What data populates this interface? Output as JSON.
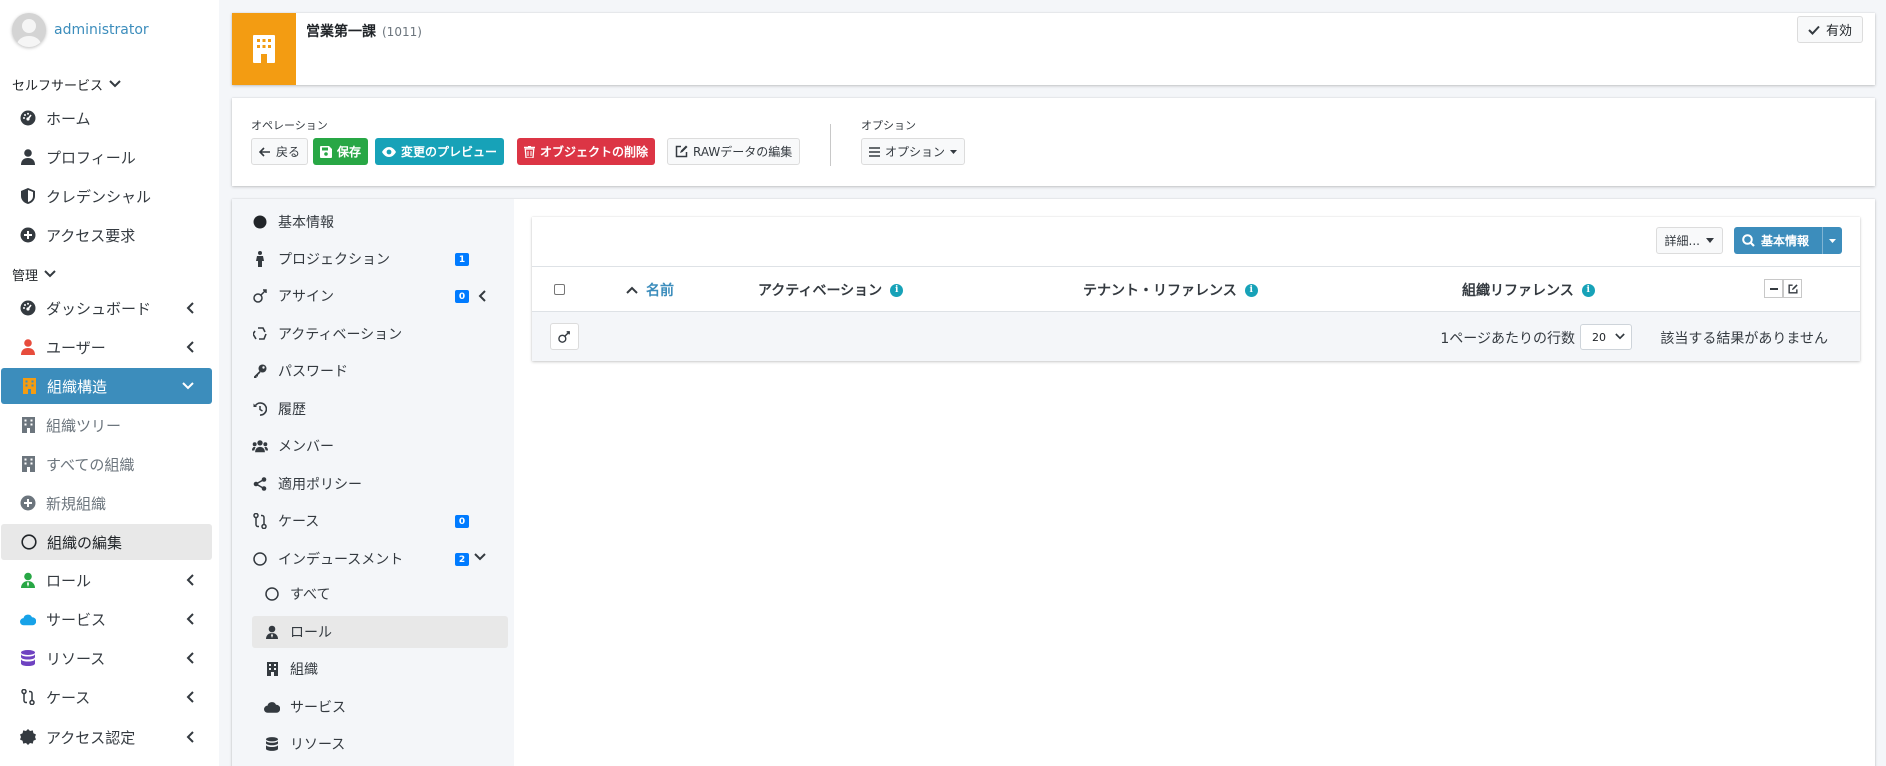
{
  "user": {
    "name": "administrator"
  },
  "sidebar": {
    "selfservice_header": "セルフサービス",
    "selfservice_items": [
      {
        "label": "ホーム",
        "icon": "dashboard-gauge-icon"
      },
      {
        "label": "プロフィール",
        "icon": "user-icon"
      },
      {
        "label": "クレデンシャル",
        "icon": "shield-icon"
      },
      {
        "label": "アクセス要求",
        "icon": "plus-circle-icon"
      }
    ],
    "admin_header": "管理",
    "admin_items": [
      {
        "label": "ダッシュボード",
        "icon": "dashboard-gauge-icon"
      },
      {
        "label": "ユーザー",
        "icon": "user-icon"
      },
      {
        "label": "組織構造",
        "icon": "building-icon"
      },
      {
        "label": "組織ツリー",
        "icon": "building-icon"
      },
      {
        "label": "すべての組織",
        "icon": "building-icon"
      },
      {
        "label": "新規組織",
        "icon": "plus-circle-icon"
      },
      {
        "label": "組織の編集",
        "icon": "circle-icon"
      },
      {
        "label": "ロール",
        "icon": "user-tie-icon"
      },
      {
        "label": "サービス",
        "icon": "cloud-icon"
      },
      {
        "label": "リソース",
        "icon": "database-icon"
      },
      {
        "label": "ケース",
        "icon": "route-icon"
      },
      {
        "label": "アクセス認定",
        "icon": "certificate-icon"
      }
    ]
  },
  "header": {
    "title": "営業第一課",
    "code": "(1011)",
    "status_label": "有効",
    "colors": {
      "org_icon_bg": "#f39c12"
    }
  },
  "operations": {
    "label": "オペレーション",
    "back": "戻る",
    "save": "保存",
    "preview": "変更のプレビュー",
    "delete": "オブジェクトの削除",
    "raw": "RAWデータの編集",
    "options_label": "オプション",
    "options_button": "オプション"
  },
  "tabs": {
    "items": [
      {
        "label": "基本情報",
        "icon": "circle-solid-icon"
      },
      {
        "label": "プロジェクション",
        "icon": "person-icon",
        "badge": "1"
      },
      {
        "label": "アサイン",
        "icon": "user-plus-icon",
        "badge": "0"
      },
      {
        "label": "アクティベーション",
        "icon": "recycle-icon"
      },
      {
        "label": "パスワード",
        "icon": "key-icon"
      },
      {
        "label": "履歴",
        "icon": "history-icon"
      },
      {
        "label": "メンバー",
        "icon": "users-icon"
      },
      {
        "label": "適用ポリシー",
        "icon": "share-nodes-icon"
      },
      {
        "label": "ケース",
        "icon": "route-icon",
        "badge": "0"
      },
      {
        "label": "インデュースメント",
        "icon": "circle-icon",
        "badge": "2"
      }
    ],
    "sub_items": [
      {
        "label": "すべて",
        "icon": "circle-icon"
      },
      {
        "label": "ロール",
        "icon": "user-tie-icon"
      },
      {
        "label": "組織",
        "icon": "building-icon"
      },
      {
        "label": "サービス",
        "icon": "cloud-icon"
      },
      {
        "label": "リソース",
        "icon": "database-icon"
      }
    ]
  },
  "table": {
    "detail_button": "詳細...",
    "search_button": "基本情報",
    "columns": [
      "名前",
      "アクティベーション",
      "テナント・リファレンス",
      "組織リファレンス"
    ],
    "rows_per_page_label": "1ページあたりの行数",
    "rows_per_page_value": "20",
    "no_results": "該当する結果がありません"
  }
}
